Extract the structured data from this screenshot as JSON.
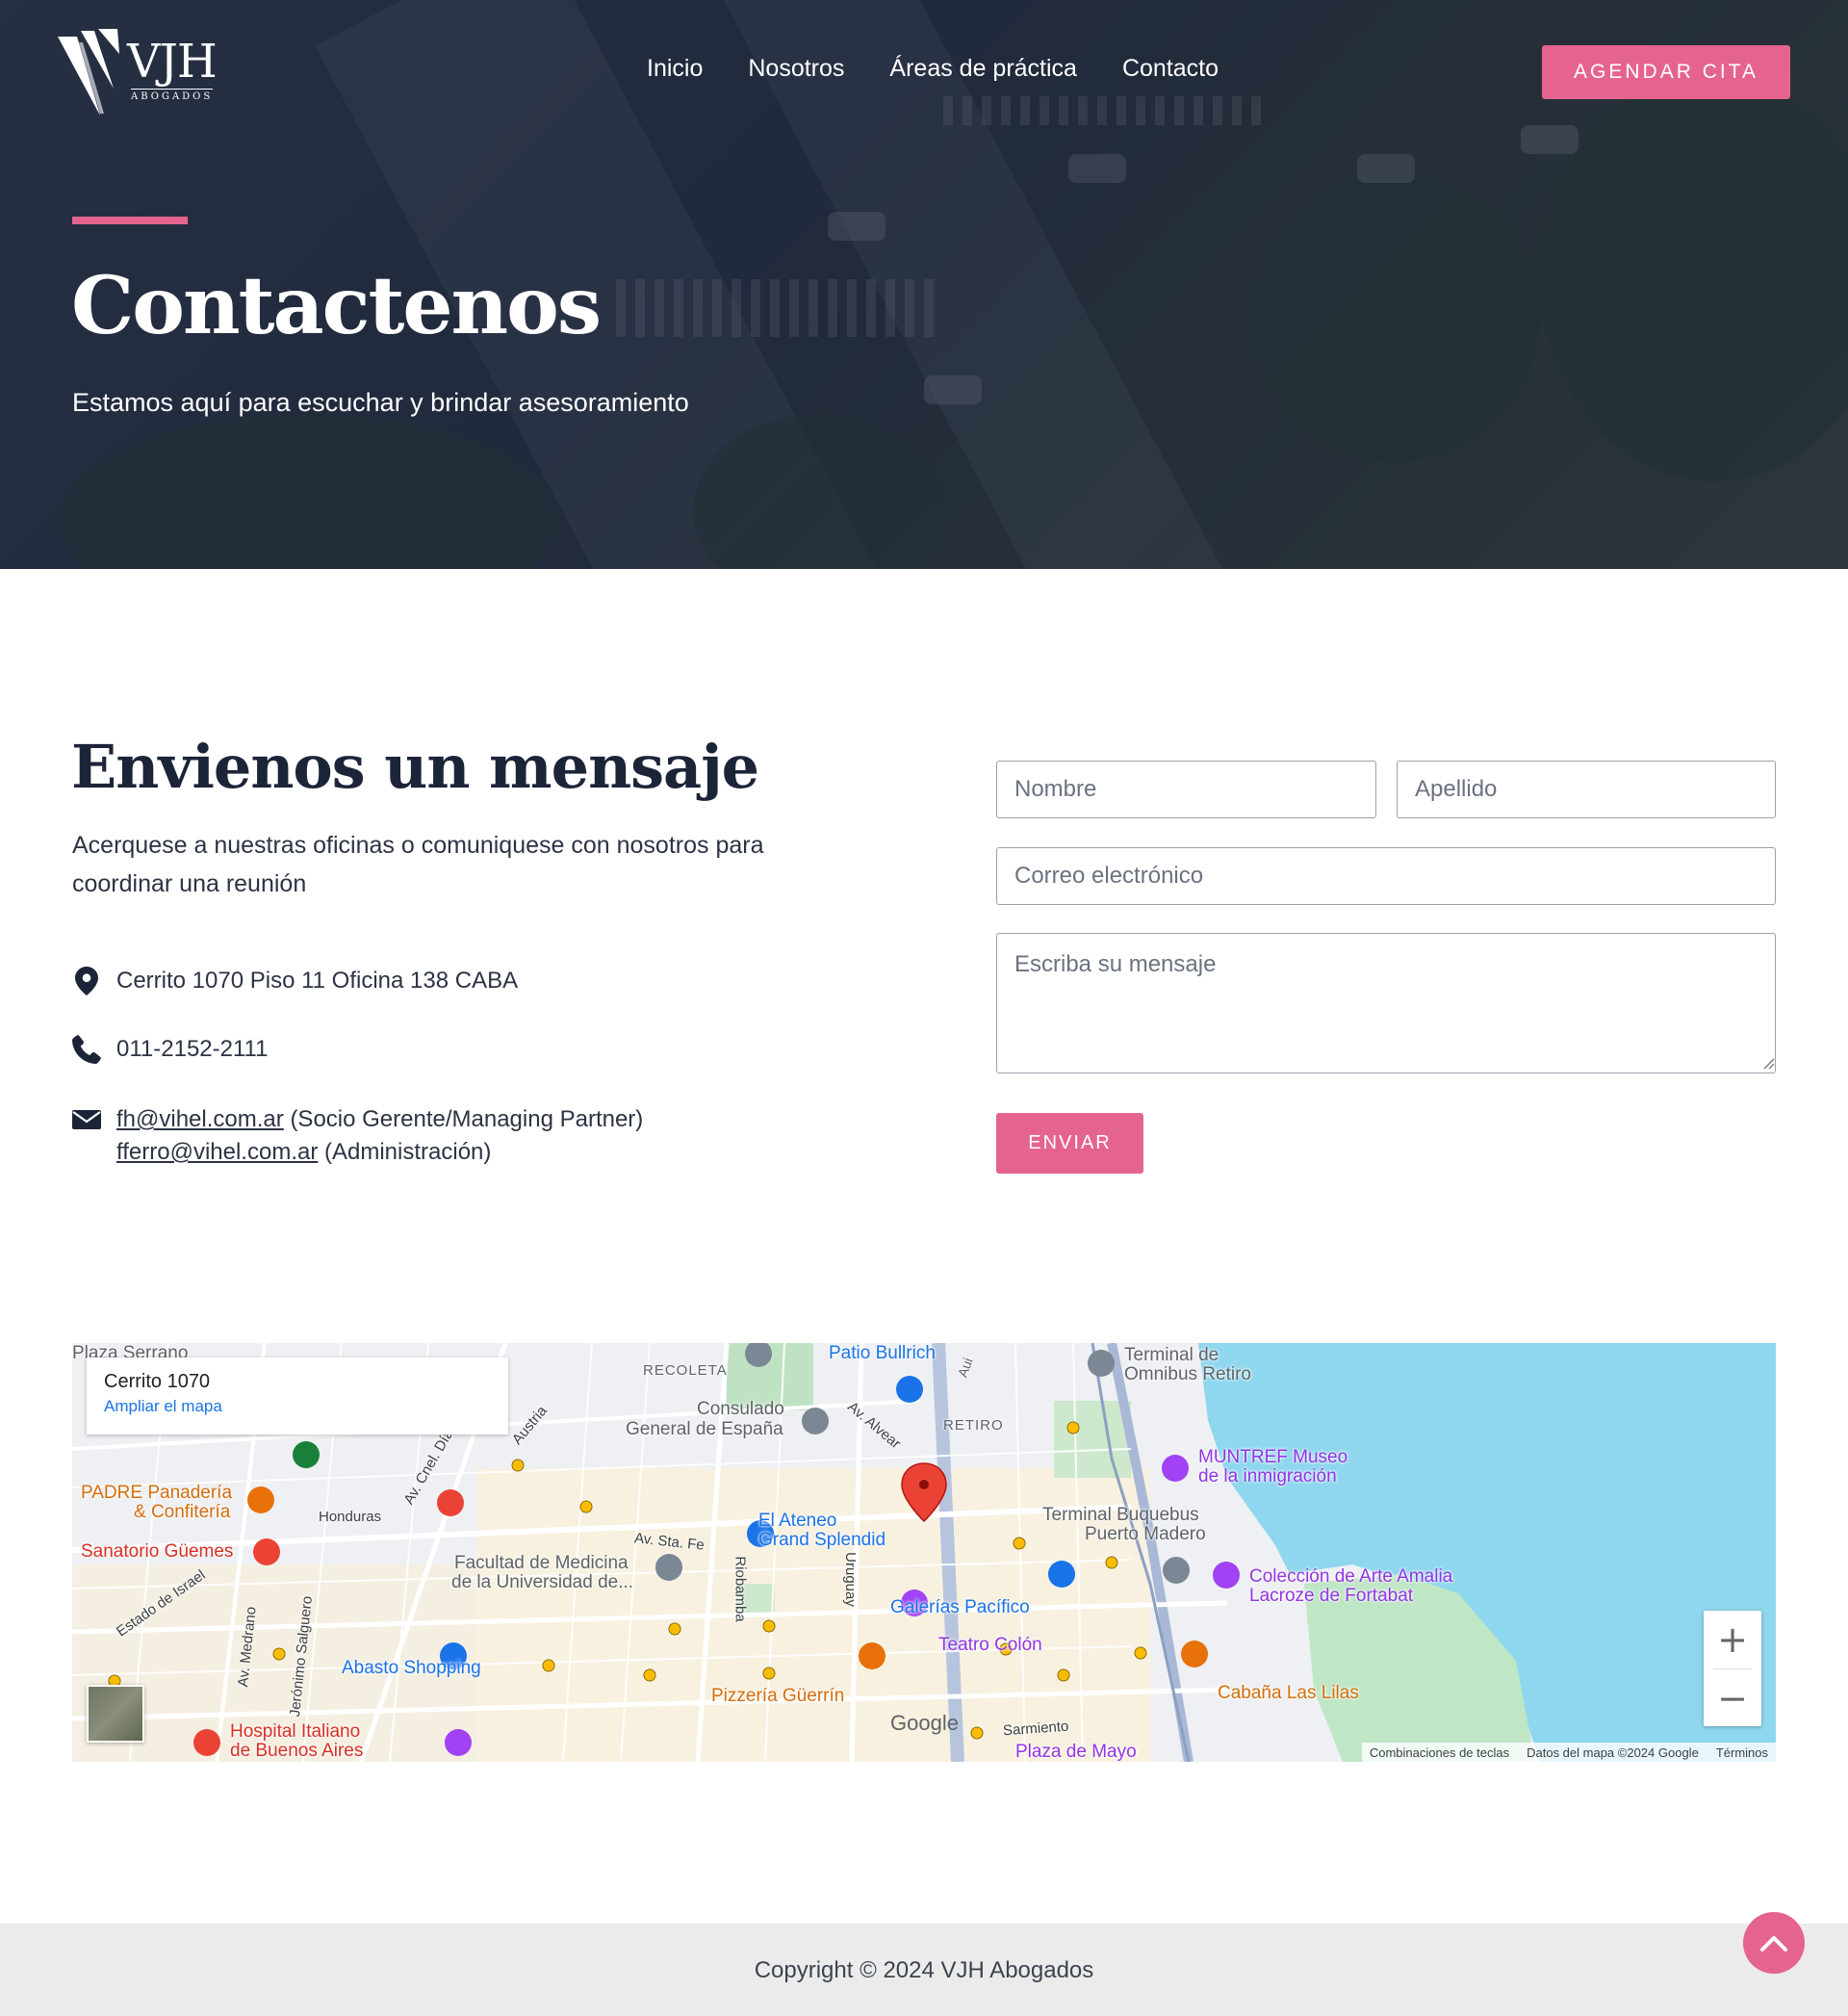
{
  "brand": {
    "logo_text": "VJH",
    "logo_subtext": "ABOGADOS",
    "accent_color": "#e5648f",
    "dark_color": "#1c2438"
  },
  "nav": {
    "items": [
      {
        "label": "Inicio"
      },
      {
        "label": "Nosotros"
      },
      {
        "label": "Áreas de práctica"
      },
      {
        "label": "Contacto"
      }
    ],
    "cta_label": "AGENDAR CITA"
  },
  "hero": {
    "title": "Contactenos",
    "subtitle": "Estamos aquí para escuchar y brindar asesoramiento"
  },
  "contact": {
    "title": "Envienos un mensaje",
    "text": "Acerquese a nuestras oficinas o comuniquese con nosotros para coordinar una reunión",
    "address": "Cerrito 1070 Piso 11 Oficina 138 CABA",
    "phone": "011-2152-2111",
    "emails": [
      {
        "email": "fh@vihel.com.ar",
        "role": "(Socio Gerente/Managing Partner)"
      },
      {
        "email": "fferro@vihel.com.ar",
        "role": "(Administración)"
      }
    ],
    "icons": [
      "map-pin-icon",
      "phone-icon",
      "envelope-icon"
    ]
  },
  "form": {
    "first_name_placeholder": "Nombre",
    "last_name_placeholder": "Apellido",
    "email_placeholder": "Correo electrónico",
    "message_placeholder": "Escriba su mensaje",
    "submit_label": "ENVIAR"
  },
  "map": {
    "place_title": "Cerrito 1070",
    "expand_link": "Ampliar el mapa",
    "labels": {
      "plaza_serrano": "Plaza Serrano",
      "recoleta": "RECOLETA",
      "patio_bullrich": "Patio Bullrich",
      "terminal_omnibus_1": "Terminal de",
      "terminal_omnibus_2": "Omnibus Retiro",
      "consulado_1": "Consulado",
      "consulado_2": "General de España",
      "av_alvear": "Av. Alvear",
      "retiro": "RETIRO",
      "austria": "Austria",
      "cnel_diaz": "Av. Cnel. Díaz",
      "muntref_1": "MUNTREF Museo",
      "muntref_2": "de la inmigración",
      "padre_1": "PADRE Panadería",
      "padre_2": "& Confitería",
      "honduras": "Honduras",
      "ateneo_1": "El Ateneo",
      "ateneo_2": "Grand Splendid",
      "terminal_buquebus_1": "Terminal Buquebus",
      "terminal_buquebus_2": "Puerto Madero",
      "sanatorio": "Sanatorio Güemes",
      "av_sta_fe": "Av. Sta. Fe",
      "facultad_1": "Facultad de Medicina",
      "facultad_2": "de la Universidad de...",
      "riobamba": "Riobamba",
      "uruguay": "Uruguay",
      "estado_israel": "Estado de Israel",
      "galerias": "Galerías Pacífico",
      "coleccion_1": "Colección de Arte Amalia",
      "coleccion_2": "Lacroze de Fortabat",
      "av_medrano": "Av. Medrano",
      "jeronimo": "Jerónimo Salguero",
      "teatro_colon": "Teatro Colón",
      "abasto": "Abasto Shopping",
      "pizzeria": "Pizzería Güerrín",
      "cabana": "Cabaña Las Lilas",
      "hospital_1": "Hospital Italiano",
      "hospital_2": "de Buenos Aires",
      "sarmiento": "Sarmiento",
      "plaza_mayo": "Plaza de Mayo",
      "aui": "Aui"
    },
    "google_logo": "Google",
    "attribution": {
      "shortcuts": "Combinaciones de teclas",
      "data": "Datos del mapa ©2024 Google",
      "terms": "Términos"
    },
    "zoom_in": "+",
    "zoom_out": "−"
  },
  "footer": {
    "copyright": "Copyright © 2024 VJH Abogados"
  }
}
